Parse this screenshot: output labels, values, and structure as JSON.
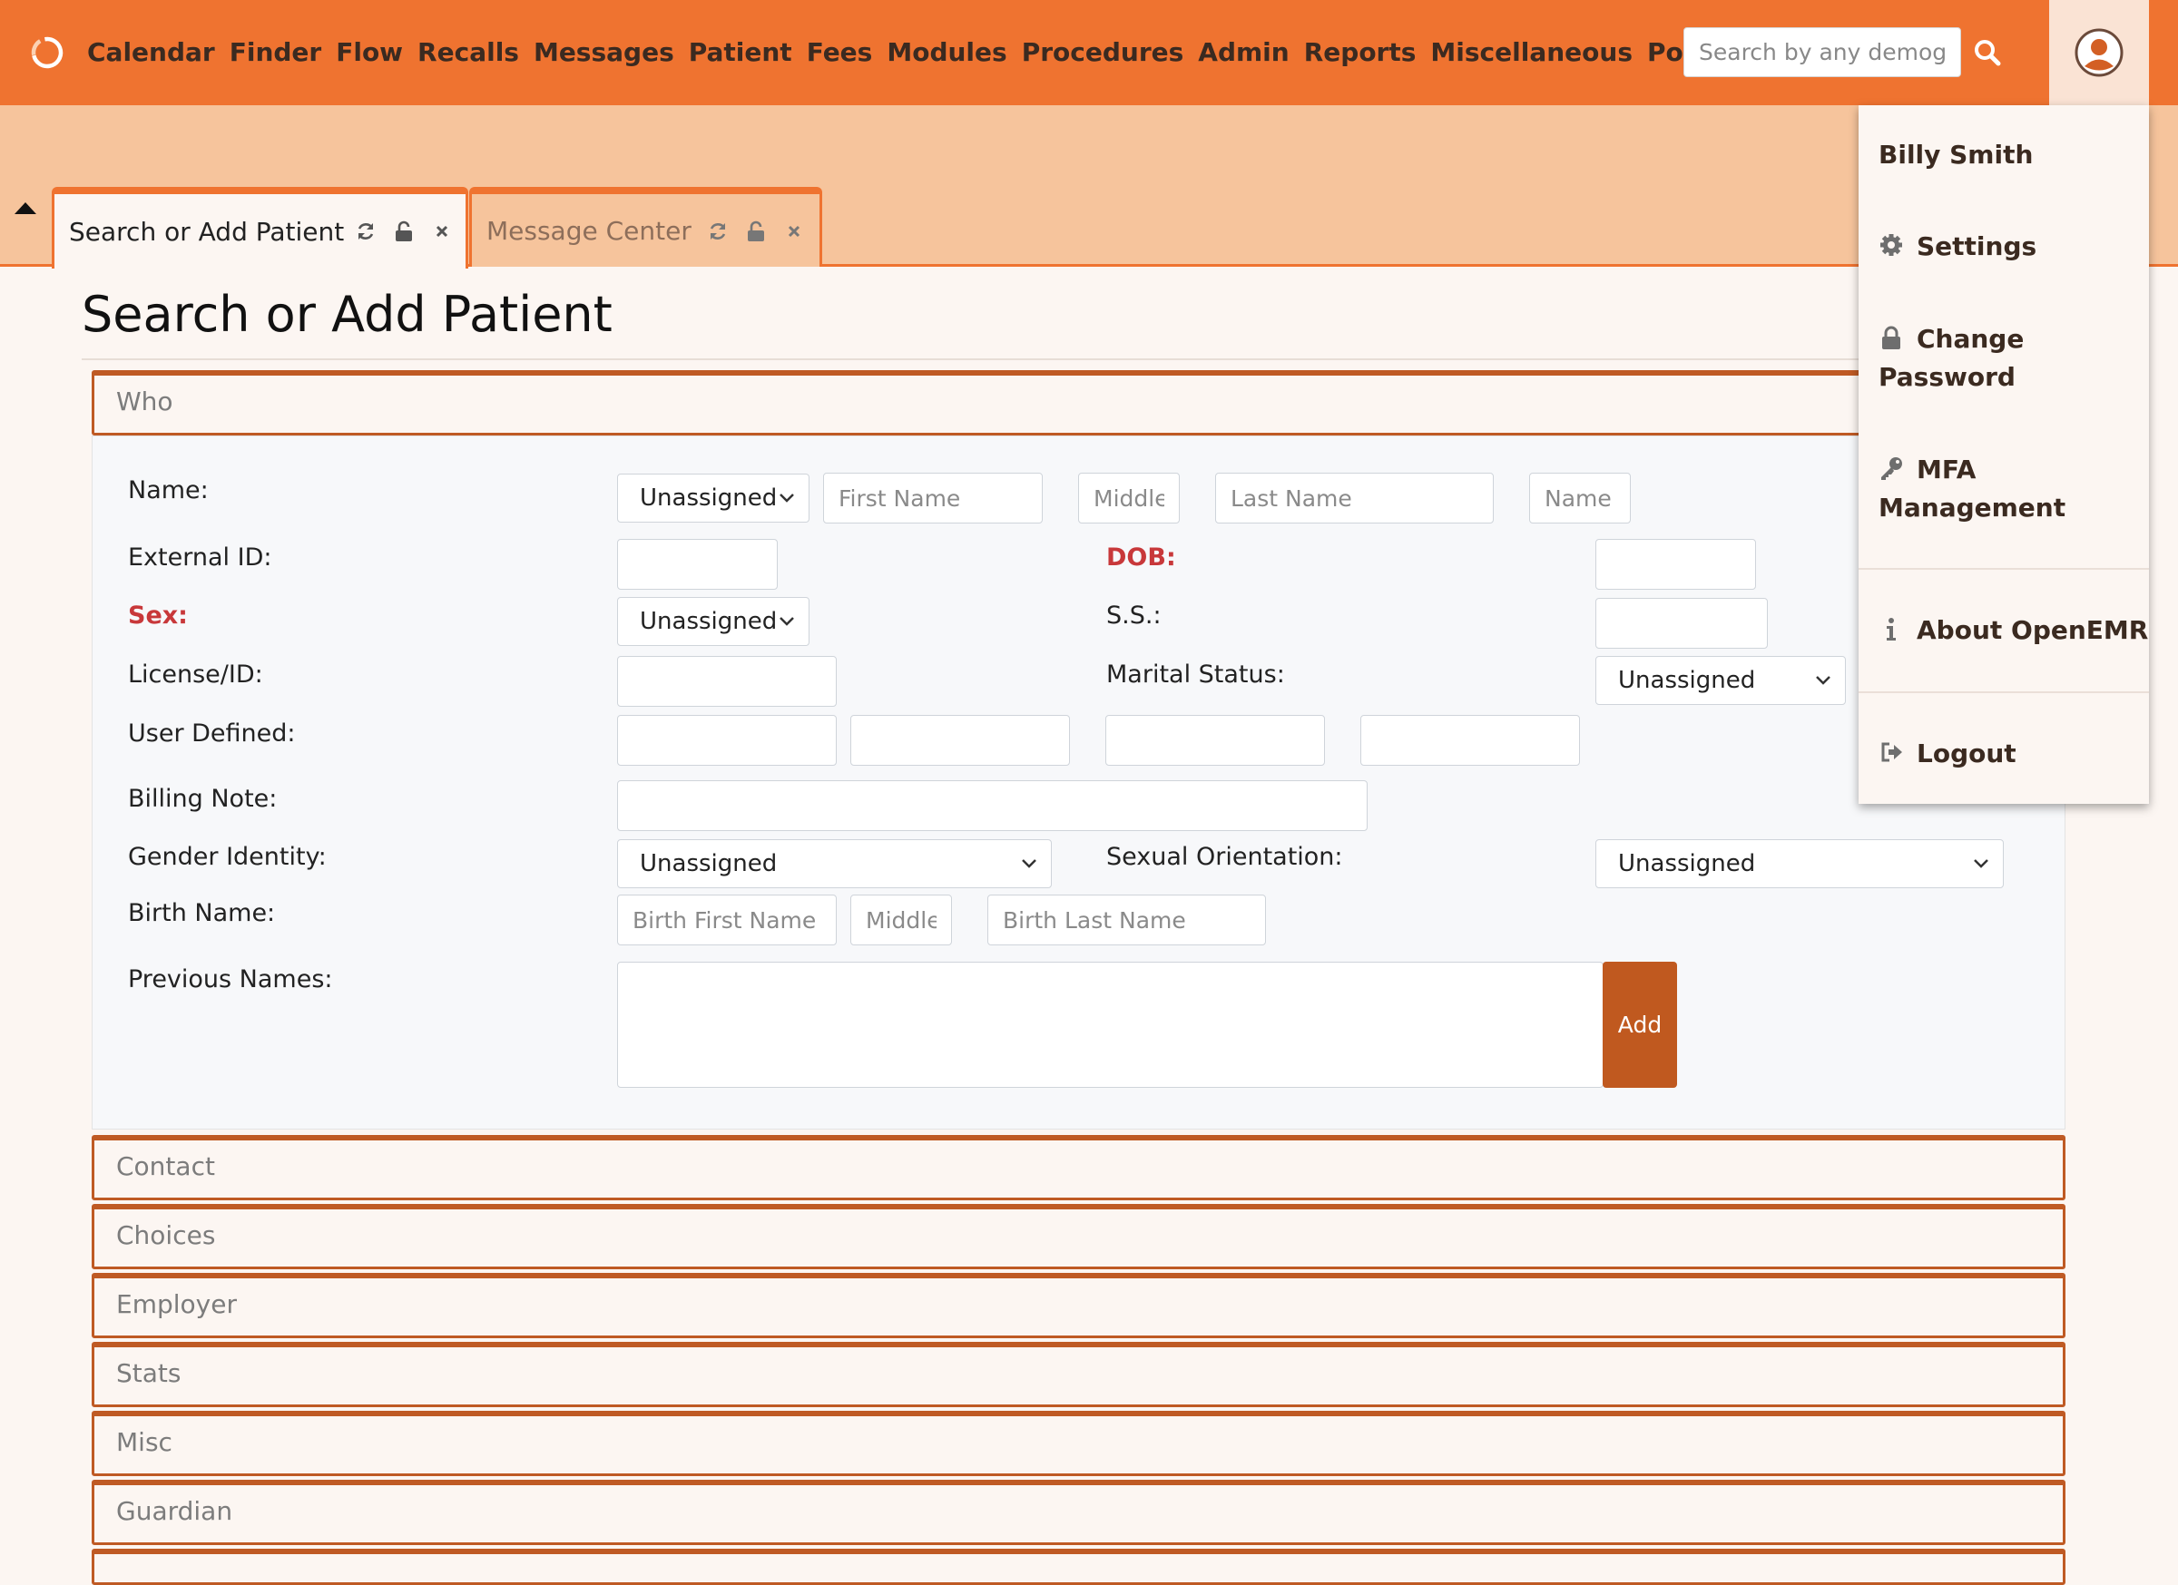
{
  "nav": {
    "menu": [
      "Calendar",
      "Finder",
      "Flow",
      "Recalls",
      "Messages",
      "Patient",
      "Fees",
      "Modules",
      "Procedures",
      "Admin",
      "Reports",
      "Miscellaneous",
      "Popups"
    ],
    "search_placeholder": "Search by any demographics"
  },
  "tabs": [
    {
      "title": "Search or Add Patient",
      "active": true
    },
    {
      "title": "Message Center",
      "active": false
    }
  ],
  "page": {
    "title": "Search or Add Patient"
  },
  "sections": {
    "who": "Who",
    "collapsed": [
      "Contact",
      "Choices",
      "Employer",
      "Stats",
      "Misc",
      "Guardian"
    ]
  },
  "form": {
    "name_label": "Name:",
    "title_select": "Unassigned",
    "first_name_placeholder": "First Name",
    "middle_placeholder": "Middle",
    "last_name_placeholder": "Last Name",
    "suffix_placeholder": "Name Suffix",
    "external_id_label": "External ID:",
    "dob_label": "DOB:",
    "sex_label": "Sex:",
    "sex_select": "Unassigned",
    "ss_label": "S.S.:",
    "license_label": "License/ID:",
    "marital_label": "Marital Status:",
    "marital_select": "Unassigned",
    "user_defined_label": "User Defined:",
    "billing_note_label": "Billing Note:",
    "gender_identity_label": "Gender Identity:",
    "gender_identity_select": "Unassigned",
    "sexual_orientation_label": "Sexual Orientation:",
    "sexual_orientation_select": "Unassigned",
    "birth_name_label": "Birth Name:",
    "birth_first_placeholder": "Birth First Name",
    "birth_middle_placeholder": "Middle",
    "birth_last_placeholder": "Birth Last Name",
    "previous_names_label": "Previous Names:",
    "add_button": "Add"
  },
  "user_menu": {
    "user_name": "Billy Smith",
    "settings": "Settings",
    "change_password_line1": "Change",
    "change_password_line2": "Password",
    "mfa_line1": "MFA",
    "mfa_line2": "Management",
    "about": "About OpenEMR",
    "logout": "Logout"
  },
  "colors": {
    "primary": "#ef7330",
    "tab_strip": "#f6c49c",
    "accent_dark": "#c0591f",
    "required": "#c8383a"
  }
}
